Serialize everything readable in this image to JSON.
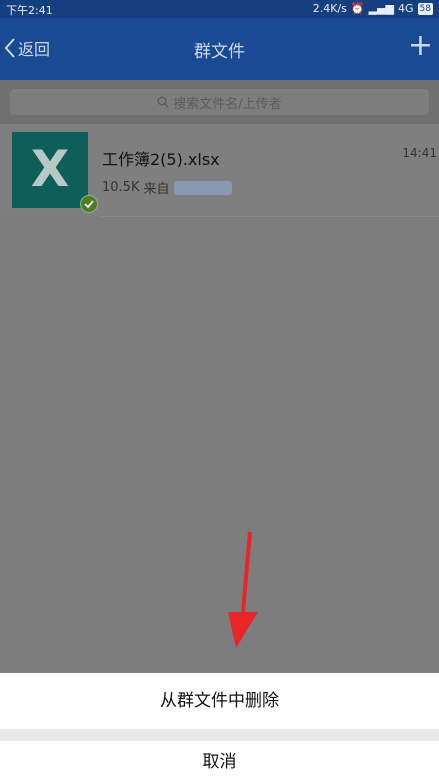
{
  "status_bar": {
    "time": "下午2:41",
    "network_speed": "2.4K/s",
    "network_type": "4G",
    "battery": "58"
  },
  "header": {
    "back_label": "返回",
    "title": "群文件",
    "add_symbol": "+"
  },
  "search": {
    "placeholder": "搜索文件名/上传者"
  },
  "files": [
    {
      "name": "工作簿2(5).xlsx",
      "size": "10.5K",
      "from_label": "来自",
      "time": "14:41",
      "icon_letter": "X"
    }
  ],
  "action_sheet": {
    "delete_label": "从群文件中删除",
    "cancel_label": "取消"
  },
  "colors": {
    "header": "#1a4a94",
    "overlay": "#7d7d7d",
    "excel_icon": "#0e5f5a",
    "arrow": "#e8262a"
  }
}
